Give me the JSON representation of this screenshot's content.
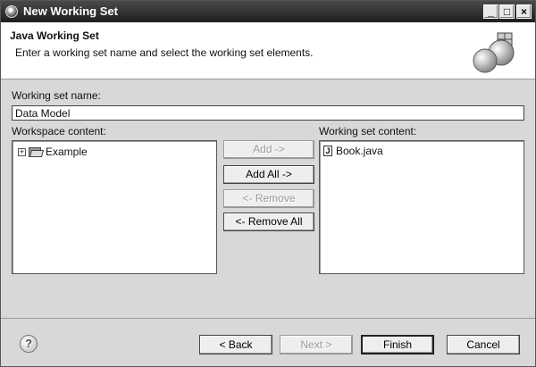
{
  "window": {
    "title": "New Working Set",
    "minimize_glyph": "_",
    "maximize_glyph": "□",
    "close_glyph": "×"
  },
  "header": {
    "title": "Java Working Set",
    "description": "Enter a working set name and select the working set elements."
  },
  "name_field": {
    "label": "Working set name:",
    "value": "Data Model"
  },
  "workspace": {
    "label": "Workspace content:",
    "items": [
      {
        "label": "Example",
        "expander": "+",
        "icon": "folder-icon"
      }
    ]
  },
  "working_set": {
    "label": "Working set content:",
    "items": [
      {
        "label": "Book.java",
        "icon": "java-file-icon",
        "icon_glyph": "J"
      }
    ]
  },
  "transfer_buttons": {
    "add": "Add ->",
    "add_all": "Add All ->",
    "remove": "<- Remove",
    "remove_all": "<- Remove All"
  },
  "footer": {
    "help_glyph": "?",
    "back": "< Back",
    "next": "Next >",
    "finish": "Finish",
    "cancel": "Cancel"
  }
}
